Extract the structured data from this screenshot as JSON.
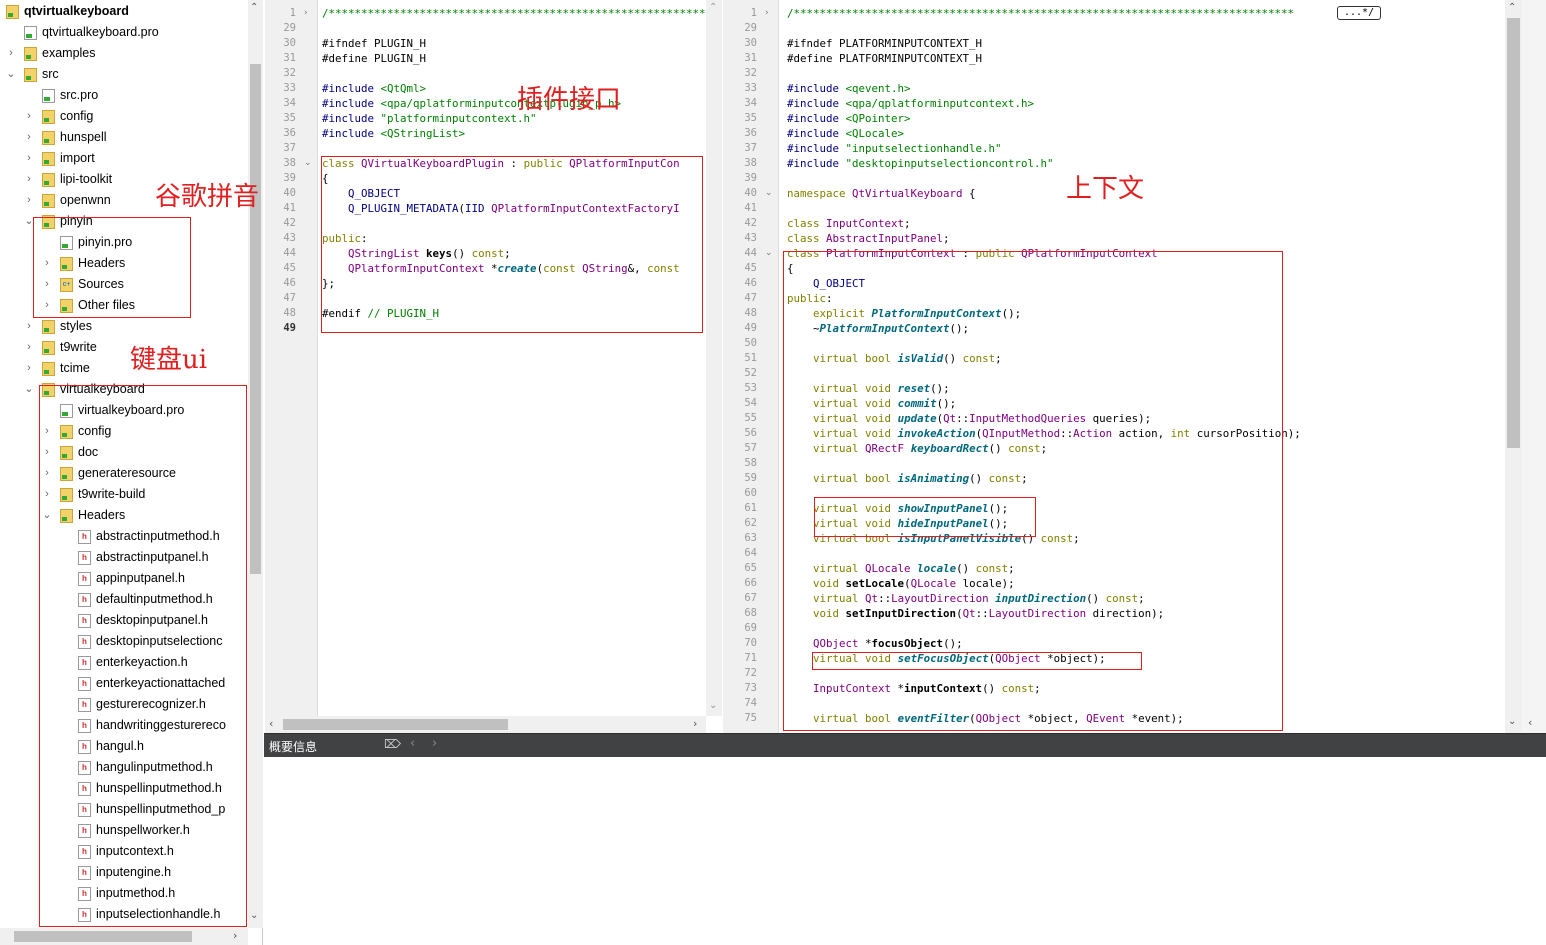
{
  "tree": {
    "items": [
      {
        "label": "qtvirtualkeyboard",
        "icon": "project-icon",
        "expanded": true,
        "bold": true
      },
      {
        "label": "qtvirtualkeyboard.pro",
        "icon": "pro-file-icon"
      },
      {
        "label": "examples",
        "icon": "folder-icon",
        "arrow": "right"
      },
      {
        "label": "src",
        "icon": "folder-icon",
        "arrow": "down"
      },
      {
        "label": "src.pro",
        "icon": "pro-file-icon"
      },
      {
        "label": "config",
        "icon": "folder-icon",
        "arrow": "right"
      },
      {
        "label": "hunspell",
        "icon": "folder-icon",
        "arrow": "right"
      },
      {
        "label": "import",
        "icon": "folder-icon",
        "arrow": "right"
      },
      {
        "label": "lipi-toolkit",
        "icon": "folder-icon",
        "arrow": "right"
      },
      {
        "label": "openwnn",
        "icon": "folder-icon",
        "arrow": "right"
      },
      {
        "label": "pinyin",
        "icon": "folder-icon",
        "arrow": "down"
      },
      {
        "label": "pinyin.pro",
        "icon": "pro-file-icon"
      },
      {
        "label": "Headers",
        "icon": "folder-icon",
        "arrow": "right"
      },
      {
        "label": "Sources",
        "icon": "sources-folder-icon",
        "arrow": "right"
      },
      {
        "label": "Other files",
        "icon": "other-files-icon",
        "arrow": "right"
      },
      {
        "label": "styles",
        "icon": "folder-icon",
        "arrow": "right"
      },
      {
        "label": "t9write",
        "icon": "folder-icon",
        "arrow": "right"
      },
      {
        "label": "tcime",
        "icon": "folder-icon",
        "arrow": "right"
      },
      {
        "label": "virtualkeyboard",
        "icon": "folder-icon",
        "arrow": "down"
      },
      {
        "label": "virtualkeyboard.pro",
        "icon": "pro-file-icon"
      },
      {
        "label": "config",
        "icon": "folder-icon",
        "arrow": "right"
      },
      {
        "label": "doc",
        "icon": "folder-icon",
        "arrow": "right"
      },
      {
        "label": "generateresource",
        "icon": "folder-icon",
        "arrow": "right"
      },
      {
        "label": "t9write-build",
        "icon": "folder-icon",
        "arrow": "right"
      },
      {
        "label": "Headers",
        "icon": "folder-icon",
        "arrow": "down"
      },
      {
        "label": "abstractinputmethod.h",
        "icon": "header-file-icon"
      },
      {
        "label": "abstractinputpanel.h",
        "icon": "header-file-icon"
      },
      {
        "label": "appinputpanel.h",
        "icon": "header-file-icon"
      },
      {
        "label": "defaultinputmethod.h",
        "icon": "header-file-icon"
      },
      {
        "label": "desktopinputpanel.h",
        "icon": "header-file-icon"
      },
      {
        "label": "desktopinputselectionc",
        "icon": "header-file-icon"
      },
      {
        "label": "enterkeyaction.h",
        "icon": "header-file-icon"
      },
      {
        "label": "enterkeyactionattached",
        "icon": "header-file-icon"
      },
      {
        "label": "gesturerecognizer.h",
        "icon": "header-file-icon"
      },
      {
        "label": "handwritinggesturereco",
        "icon": "header-file-icon"
      },
      {
        "label": "hangul.h",
        "icon": "header-file-icon"
      },
      {
        "label": "hangulinputmethod.h",
        "icon": "header-file-icon"
      },
      {
        "label": "hunspellinputmethod.h",
        "icon": "header-file-icon"
      },
      {
        "label": "hunspellinputmethod_p",
        "icon": "header-file-icon"
      },
      {
        "label": "hunspellworker.h",
        "icon": "header-file-icon"
      },
      {
        "label": "inputcontext.h",
        "icon": "header-file-icon"
      },
      {
        "label": "inputengine.h",
        "icon": "header-file-icon"
      },
      {
        "label": "inputmethod.h",
        "icon": "header-file-icon"
      },
      {
        "label": "inputselectionhandle.h",
        "icon": "header-file-icon"
      }
    ]
  },
  "annotations": {
    "pinyin": "谷歌拼音",
    "keyboard_ui": "键盘ui",
    "plugin": "插件接口",
    "context": "上下文"
  },
  "editor1": {
    "lines": [
      {
        "n": "1",
        "fold": "›",
        "text": "/*****************************************************************************"
      },
      {
        "n": "29",
        "text": ""
      },
      {
        "n": "30",
        "text": "#ifndef PLUGIN_H"
      },
      {
        "n": "31",
        "text": "#define PLUGIN_H"
      },
      {
        "n": "32",
        "text": ""
      },
      {
        "n": "33",
        "text": "#include <QtQml>"
      },
      {
        "n": "34",
        "text": "#include <qpa/qplatforminputcontextplugin_p.h>"
      },
      {
        "n": "35",
        "text": "#include \"platforminputcontext.h\""
      },
      {
        "n": "36",
        "text": "#include <QStringList>"
      },
      {
        "n": "37",
        "text": ""
      },
      {
        "n": "38",
        "fold": "⌄",
        "text": "class QVirtualKeyboardPlugin : public QPlatformInputCon"
      },
      {
        "n": "39",
        "text": "{"
      },
      {
        "n": "40",
        "text": "    Q_OBJECT"
      },
      {
        "n": "41",
        "text": "    Q_PLUGIN_METADATA(IID QPlatformInputContextFactoryI"
      },
      {
        "n": "42",
        "text": ""
      },
      {
        "n": "43",
        "text": "public:"
      },
      {
        "n": "44",
        "text": "    QStringList keys() const;"
      },
      {
        "n": "45",
        "text": "    QPlatformInputContext *create(const QString&, const"
      },
      {
        "n": "46",
        "text": "};"
      },
      {
        "n": "47",
        "text": ""
      },
      {
        "n": "48",
        "text": "#endif // PLUGIN_H"
      },
      {
        "n": "49",
        "text": ""
      }
    ]
  },
  "editor2": {
    "fold_marker": "...*/",
    "lines": [
      {
        "n": "1",
        "fold": "›",
        "text": "/*****************************************************************************"
      },
      {
        "n": "29",
        "text": ""
      },
      {
        "n": "30",
        "text": "#ifndef PLATFORMINPUTCONTEXT_H"
      },
      {
        "n": "31",
        "text": "#define PLATFORMINPUTCONTEXT_H"
      },
      {
        "n": "32",
        "text": ""
      },
      {
        "n": "33",
        "text": "#include <qevent.h>"
      },
      {
        "n": "34",
        "text": "#include <qpa/qplatforminputcontext.h>"
      },
      {
        "n": "35",
        "text": "#include <QPointer>"
      },
      {
        "n": "36",
        "text": "#include <QLocale>"
      },
      {
        "n": "37",
        "text": "#include \"inputselectionhandle.h\""
      },
      {
        "n": "38",
        "text": "#include \"desktopinputselectioncontrol.h\""
      },
      {
        "n": "39",
        "text": ""
      },
      {
        "n": "40",
        "fold": "⌄",
        "text": "namespace QtVirtualKeyboard {"
      },
      {
        "n": "41",
        "text": ""
      },
      {
        "n": "42",
        "text": "class InputContext;"
      },
      {
        "n": "43",
        "text": "class AbstractInputPanel;"
      },
      {
        "n": "44",
        "fold": "⌄",
        "text": "class PlatformInputContext : public QPlatformInputContext"
      },
      {
        "n": "45",
        "text": "{"
      },
      {
        "n": "46",
        "text": "    Q_OBJECT"
      },
      {
        "n": "47",
        "text": "public:"
      },
      {
        "n": "48",
        "text": "    explicit PlatformInputContext();"
      },
      {
        "n": "49",
        "text": "    ~PlatformInputContext();"
      },
      {
        "n": "50",
        "text": ""
      },
      {
        "n": "51",
        "text": "    virtual bool isValid() const;"
      },
      {
        "n": "52",
        "text": ""
      },
      {
        "n": "53",
        "text": "    virtual void reset();"
      },
      {
        "n": "54",
        "text": "    virtual void commit();"
      },
      {
        "n": "55",
        "text": "    virtual void update(Qt::InputMethodQueries queries);"
      },
      {
        "n": "56",
        "text": "    virtual void invokeAction(QInputMethod::Action action, int cursorPosition);"
      },
      {
        "n": "57",
        "text": "    virtual QRectF keyboardRect() const;"
      },
      {
        "n": "58",
        "text": ""
      },
      {
        "n": "59",
        "text": "    virtual bool isAnimating() const;"
      },
      {
        "n": "60",
        "text": ""
      },
      {
        "n": "61",
        "text": "    virtual void showInputPanel();"
      },
      {
        "n": "62",
        "text": "    virtual void hideInputPanel();"
      },
      {
        "n": "63",
        "text": "    virtual bool isInputPanelVisible() const;"
      },
      {
        "n": "64",
        "text": ""
      },
      {
        "n": "65",
        "text": "    virtual QLocale locale() const;"
      },
      {
        "n": "66",
        "text": "    void setLocale(QLocale locale);"
      },
      {
        "n": "67",
        "text": "    virtual Qt::LayoutDirection inputDirection() const;"
      },
      {
        "n": "68",
        "text": "    void setInputDirection(Qt::LayoutDirection direction);"
      },
      {
        "n": "69",
        "text": ""
      },
      {
        "n": "70",
        "text": "    QObject *focusObject();"
      },
      {
        "n": "71",
        "text": "    virtual void setFocusObject(QObject *object);"
      },
      {
        "n": "72",
        "text": ""
      },
      {
        "n": "73",
        "text": "    InputContext *inputContext() const;"
      },
      {
        "n": "74",
        "text": ""
      },
      {
        "n": "75",
        "text": "    virtual bool eventFilter(QObject *object, QEvent *event);"
      }
    ]
  },
  "output_panel": {
    "title": "概要信息"
  },
  "colors": {
    "annotation_red": "#e02020",
    "keyword": "#808000",
    "type": "#800080",
    "string": "#008000",
    "function": "#00677c"
  }
}
